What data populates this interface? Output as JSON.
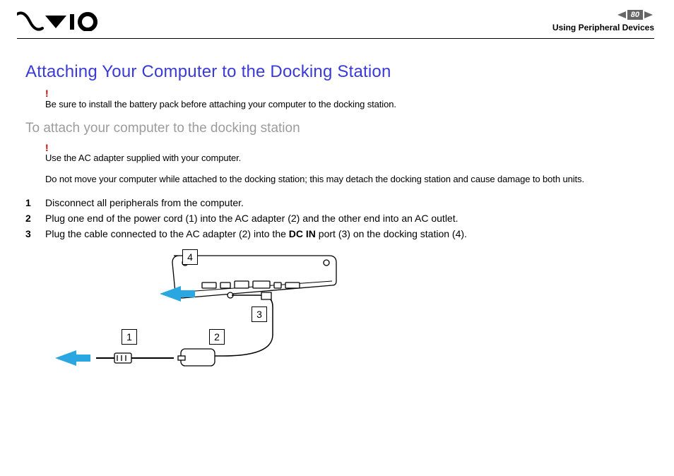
{
  "header": {
    "page_number": "80",
    "breadcrumb": "Using Peripheral Devices"
  },
  "content": {
    "title": "Attaching Your Computer to the Docking Station",
    "warn1": "Be sure to install the battery pack before attaching your computer to the docking station.",
    "subtitle": "To attach your computer to the docking station",
    "warn2": "Use the AC adapter supplied with your computer.",
    "warn3": "Do not move your computer while attached to the docking station; this may detach the docking station and cause damage to both units.",
    "steps": [
      "Disconnect all peripherals from the computer.",
      "Plug one end of the power cord (1) into the AC adapter (2) and the other end into an AC outlet.",
      "Plug the cable connected to the AC adapter (2) into the "
    ],
    "step3_bold": "DC IN",
    "step3_tail": " port (3) on the docking station (4)."
  },
  "figure": {
    "labels": {
      "l1": "1",
      "l2": "2",
      "l3": "3",
      "l4": "4"
    }
  },
  "colors": {
    "heading": "#3a3ad6",
    "warn_mark": "#c00000",
    "arrow": "#2aa7e0",
    "page_badge_bg": "#666666"
  }
}
